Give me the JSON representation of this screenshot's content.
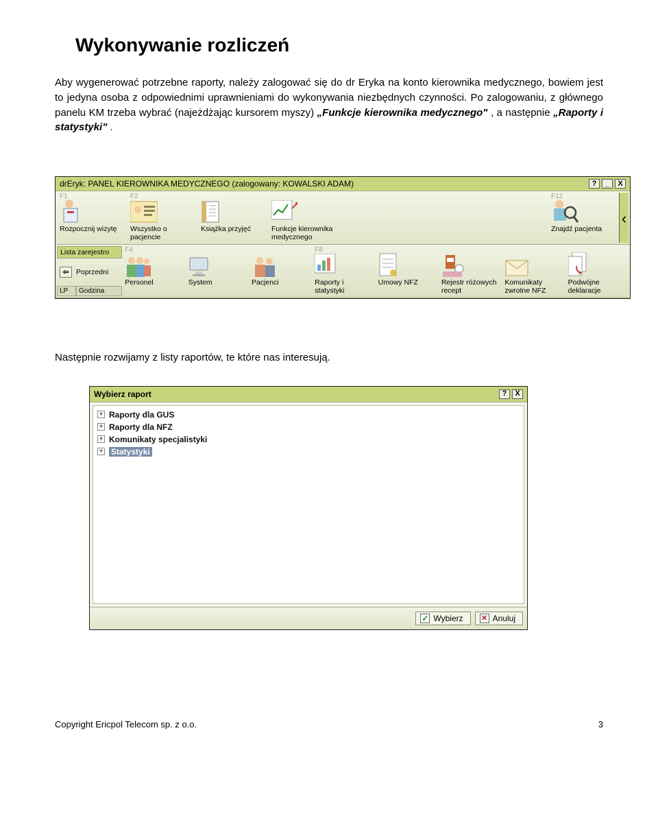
{
  "heading": "Wykonywanie rozliczeń",
  "para1_pre": "Aby wygenerować potrzebne raporty, należy zalogować się do dr Eryka na konto kierownika medycznego, bowiem jest to jedyna osoba z odpowiednimi uprawnieniami do wykonywania niezbędnych czynności. Po zalogowaniu, z głównego panelu KM trzeba wybrać (najeżdżając kursorem myszy) ",
  "para1_em1": "„Funkcje kierownika medycznego\"",
  "para1_mid": ", a następnie ",
  "para1_em2": "„Raporty i statystyki\"",
  "para1_post": ".",
  "para2": "Następnie rozwijamy z listy raportów, te które nas interesują.",
  "panel1": {
    "title": "drEryk: PANEL KIEROWNIKA MEDYCZNEGO (zalogowany: KOWALSKI ADAM)",
    "help": "?",
    "min": "_",
    "close": "X",
    "row1": [
      {
        "fk": "F1",
        "label": "Rozpocznij wizytę"
      },
      {
        "fk": "F2",
        "label": "Wszystko o pacjencie"
      },
      {
        "fk": "",
        "label": "Książka przyjęć"
      },
      {
        "fk": "",
        "label": "Funkcje kierownika medycznego"
      },
      {
        "fk": "F12",
        "label": "Znajdź pacjenta",
        "right": true
      }
    ],
    "arrow": "‹",
    "leftcol": {
      "list": "Lista zarejestro",
      "prev_label": "Poprzedni",
      "prev_arrow": "⇦",
      "hdr1": "LP",
      "hdr2": "Godzina"
    },
    "row2": [
      {
        "fk": "F4",
        "label": "Personel"
      },
      {
        "fk": "",
        "label": "System"
      },
      {
        "fk": "",
        "label": "Pacjenci"
      },
      {
        "fk": "F8",
        "label": "Raporty i statystyki"
      },
      {
        "fk": "",
        "label": "Umowy NFZ"
      },
      {
        "fk": "",
        "label": "Rejestr różowych recept"
      },
      {
        "fk": "",
        "label": "Komunikaty zwrotne NFZ"
      },
      {
        "fk": "",
        "label": "Podwójne deklaracje"
      }
    ]
  },
  "panel2": {
    "title": "Wybierz raport",
    "help": "?",
    "close": "X",
    "plus": "+",
    "nodes": [
      {
        "label": "Raporty dla GUS",
        "sel": false
      },
      {
        "label": "Raporty dla NFZ",
        "sel": false
      },
      {
        "label": "Komunikaty specjalistyki",
        "sel": false
      },
      {
        "label": "Statystyki",
        "sel": true
      }
    ],
    "ok_label": "Wybierz",
    "ok_glyph": "✓",
    "cancel_label": "Anuluj",
    "cancel_glyph": "✕"
  },
  "footer_left": "Copyright Ericpol Telecom sp. z o.o.",
  "footer_right": "3"
}
